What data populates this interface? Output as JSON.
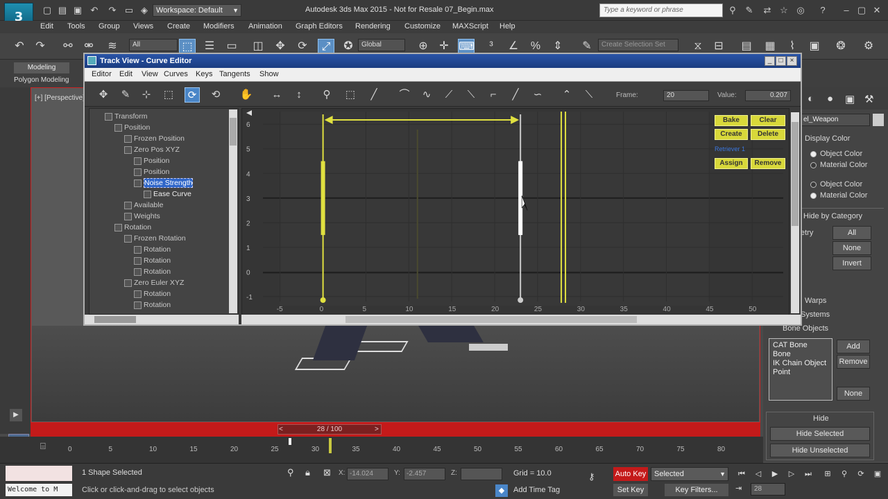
{
  "app": {
    "logo_text": "3",
    "title": "Autodesk 3ds Max 2015 - Not for Resale   07_Begin.max",
    "workspace": "Workspace: Default",
    "search_placeholder": "Type a keyword or phrase"
  },
  "menu": [
    "Edit",
    "Tools",
    "Group",
    "Views",
    "Create",
    "Modifiers",
    "Animation",
    "Graph Editors",
    "Rendering",
    "Customize",
    "MAXScript",
    "Help"
  ],
  "main_toolbar": {
    "selection_filter": "All",
    "ref_coord": "Global",
    "selection_set": "Create Selection Set"
  },
  "ribbon": {
    "tab": "Modeling",
    "sub": "Polygon Modeling"
  },
  "viewport": {
    "label": "[+] [Perspective]"
  },
  "track_view": {
    "title": "Track View - Curve Editor",
    "menus": [
      "Editor",
      "Edit",
      "View",
      "Curves",
      "Keys",
      "Tangents",
      "Show"
    ],
    "frame_label": "Frame:",
    "frame_value": "20",
    "value_label": "Value:",
    "value_value": "0.207",
    "tree": [
      {
        "label": "Transform",
        "indent": 0,
        "box": true
      },
      {
        "label": "Position",
        "indent": 1,
        "box": true
      },
      {
        "label": "Frozen Position",
        "indent": 2,
        "box": true
      },
      {
        "label": "Zero Pos XYZ",
        "indent": 2,
        "box": true
      },
      {
        "label": "Position",
        "indent": 3,
        "box": true
      },
      {
        "label": "Position",
        "indent": 3,
        "box": true
      },
      {
        "label": "Noise Strength",
        "indent": 3,
        "box": true,
        "selected": true
      },
      {
        "label": "Ease Curve",
        "indent": 4,
        "box": true,
        "bold": true
      },
      {
        "label": "Available",
        "indent": 2,
        "box": true
      },
      {
        "label": "Weights",
        "indent": 2,
        "box": true
      },
      {
        "label": "Rotation",
        "indent": 1,
        "box": true
      },
      {
        "label": "Frozen Rotation",
        "indent": 2,
        "box": true
      },
      {
        "label": "Rotation",
        "indent": 3,
        "box": true
      },
      {
        "label": "Rotation",
        "indent": 3,
        "box": true
      },
      {
        "label": "Rotation",
        "indent": 3,
        "box": true
      },
      {
        "label": "Zero Euler XYZ",
        "indent": 2,
        "box": true
      },
      {
        "label": "Rotation",
        "indent": 3,
        "box": true
      },
      {
        "label": "Rotation",
        "indent": 3,
        "box": true
      }
    ],
    "y_ticks": [
      "6",
      "5",
      "4",
      "3",
      "2",
      "1",
      "0",
      "-1"
    ],
    "x_ticks": [
      "-5",
      "0",
      "5",
      "10",
      "15",
      "20",
      "25",
      "30",
      "35",
      "40",
      "45",
      "50"
    ],
    "range_start": 0,
    "range_end": 23,
    "current_frame": 28,
    "yellow_buttons": {
      "bake": "Bake",
      "clear": "Clear",
      "create": "Create",
      "delete": "Delete",
      "assign": "Assign",
      "remove": "Remove"
    },
    "ref_label": "Retriever 1",
    "colors": {
      "range": "#e0e040",
      "handle": "#ffffff",
      "grid": "#2a2a2a"
    }
  },
  "command_panel": {
    "object_name": "el_Weapon",
    "display_color_title": "Display Color",
    "wireframe": [
      "Object Color",
      "Material Color"
    ],
    "shaded": [
      "Object Color",
      "Material Color"
    ],
    "hide_by_category_title": "Hide by Category",
    "geometry": "etry",
    "all": "All",
    "none": "None",
    "invert": "Invert",
    "warps": "Warps",
    "systems": "Systems",
    "bone_objects": "Bone Objects",
    "list": [
      "CAT Bone",
      "Bone",
      "IK Chain Object",
      "Point"
    ],
    "add": "Add",
    "remove": "Remove",
    "none2": "None",
    "hide_title": "Hide",
    "hide_selected": "Hide Selected",
    "hide_unselected": "Hide Unselected"
  },
  "timeline": {
    "slider": "28 / 100",
    "ticks": [
      "0",
      "5",
      "10",
      "15",
      "20",
      "25",
      "30",
      "35",
      "40",
      "45",
      "50",
      "55",
      "60",
      "65",
      "70",
      "75",
      "80"
    ]
  },
  "status": {
    "maxscript": "Welcome to M",
    "selection": "1 Shape Selected",
    "prompt": "Click or click-and-drag to select objects",
    "x": "-14.024",
    "y": "-2.457",
    "grid": "Grid = 10.0",
    "auto_key": "Auto Key",
    "key_mode": "Selected",
    "set_key": "Set Key",
    "key_filters": "Key Filters...",
    "add_time_tag": "Add Time Tag",
    "frame": "28"
  }
}
